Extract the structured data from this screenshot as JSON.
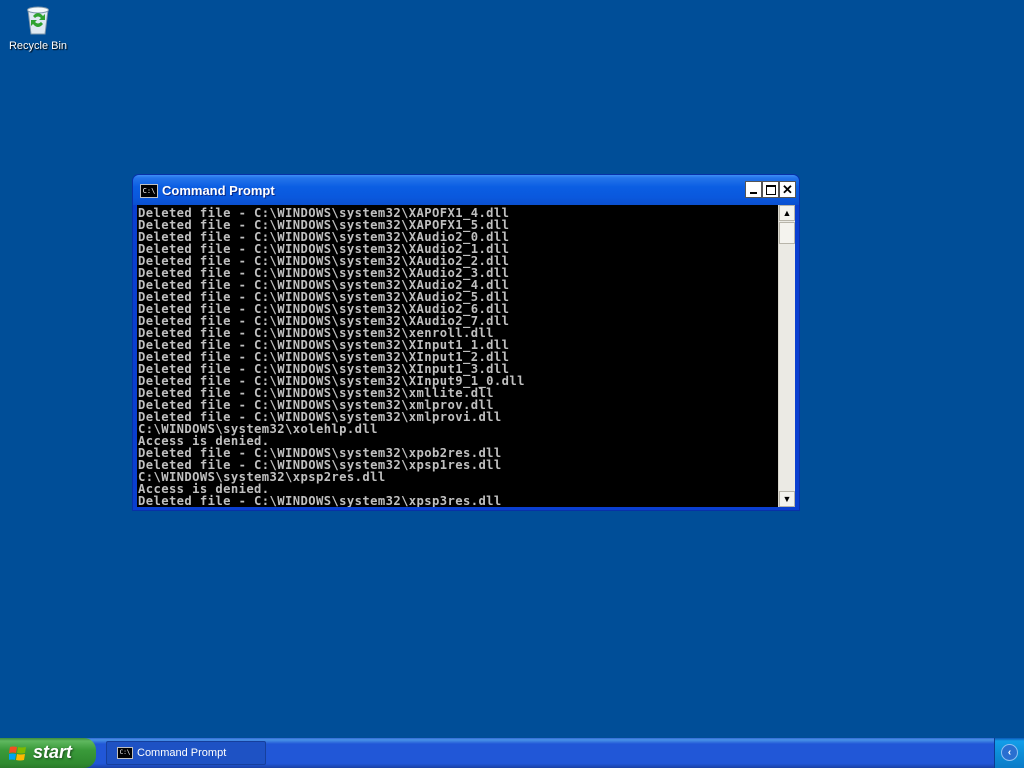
{
  "desktop": {
    "background_color": "#004e98",
    "icons": [
      {
        "label": "Recycle Bin",
        "icon": "recycle-bin-icon"
      }
    ]
  },
  "window": {
    "title": "Command Prompt",
    "icon": "cmd-icon",
    "icon_text": "C:\\",
    "controls": {
      "minimize": "minimize-icon",
      "maximize": "maximize-icon",
      "close": "close-icon",
      "close_glyph": "✕"
    },
    "console_lines": [
      "Deleted file - C:\\WINDOWS\\system32\\XAPOFX1_4.dll",
      "Deleted file - C:\\WINDOWS\\system32\\XAPOFX1_5.dll",
      "Deleted file - C:\\WINDOWS\\system32\\XAudio2_0.dll",
      "Deleted file - C:\\WINDOWS\\system32\\XAudio2_1.dll",
      "Deleted file - C:\\WINDOWS\\system32\\XAudio2_2.dll",
      "Deleted file - C:\\WINDOWS\\system32\\XAudio2_3.dll",
      "Deleted file - C:\\WINDOWS\\system32\\XAudio2_4.dll",
      "Deleted file - C:\\WINDOWS\\system32\\XAudio2_5.dll",
      "Deleted file - C:\\WINDOWS\\system32\\XAudio2_6.dll",
      "Deleted file - C:\\WINDOWS\\system32\\XAudio2_7.dll",
      "Deleted file - C:\\WINDOWS\\system32\\xenroll.dll",
      "Deleted file - C:\\WINDOWS\\system32\\XInput1_1.dll",
      "Deleted file - C:\\WINDOWS\\system32\\XInput1_2.dll",
      "Deleted file - C:\\WINDOWS\\system32\\XInput1_3.dll",
      "Deleted file - C:\\WINDOWS\\system32\\XInput9_1_0.dll",
      "Deleted file - C:\\WINDOWS\\system32\\xmllite.dll",
      "Deleted file - C:\\WINDOWS\\system32\\xmlprov.dll",
      "Deleted file - C:\\WINDOWS\\system32\\xmlprovi.dll",
      "C:\\WINDOWS\\system32\\xolehlp.dll",
      "Access is denied.",
      "Deleted file - C:\\WINDOWS\\system32\\xpob2res.dll",
      "Deleted file - C:\\WINDOWS\\system32\\xpsp1res.dll",
      "C:\\WINDOWS\\system32\\xpsp2res.dll",
      "Access is denied.",
      "Deleted file - C:\\WINDOWS\\system32\\xpsp3res.dll"
    ],
    "scrollbar": {
      "up_glyph": "▲",
      "down_glyph": "▼"
    }
  },
  "taskbar": {
    "start_label": "start",
    "start_icon": "windows-logo-icon",
    "tasks": [
      {
        "label": "Command Prompt",
        "icon": "cmd-icon",
        "icon_text": "C:\\"
      }
    ],
    "tray": {
      "chevron_glyph": "‹",
      "icon": "show-hidden-icons-chevron-icon"
    }
  }
}
